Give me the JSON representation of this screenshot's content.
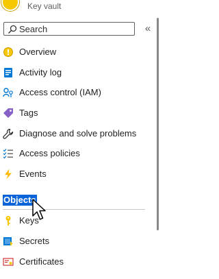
{
  "header": {
    "subtitle": "Key vault"
  },
  "search": {
    "placeholder": "Search",
    "value": ""
  },
  "collapse_glyph": "«",
  "nav": {
    "items": [
      {
        "label": "Overview",
        "icon": "overview-icon"
      },
      {
        "label": "Activity log",
        "icon": "activity-log-icon"
      },
      {
        "label": "Access control (IAM)",
        "icon": "access-control-icon"
      },
      {
        "label": "Tags",
        "icon": "tag-icon"
      },
      {
        "label": "Diagnose and solve problems",
        "icon": "wrench-icon"
      },
      {
        "label": "Access policies",
        "icon": "access-policies-icon"
      },
      {
        "label": "Events",
        "icon": "lightning-icon"
      }
    ],
    "section": {
      "heading": "Objects",
      "highlighted": true
    },
    "objects": [
      {
        "label": "Keys",
        "icon": "key-icon"
      },
      {
        "label": "Secrets",
        "icon": "secret-icon"
      },
      {
        "label": "Certificates",
        "icon": "certificate-icon"
      }
    ]
  },
  "colors": {
    "selection": "#0a64d8",
    "keyvault": "#f6c800",
    "accent": "#0078d4",
    "tag": "#8661c5",
    "events": "#ffb900"
  }
}
